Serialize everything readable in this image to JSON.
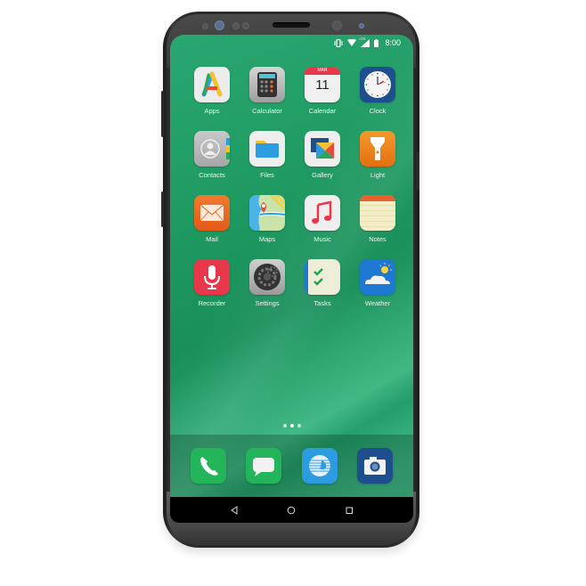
{
  "device": {
    "type": "smartphone",
    "wallpaper_colors": [
      "#2aa671",
      "#1a8f5a",
      "#39b884"
    ]
  },
  "status_bar": {
    "icons": [
      "vibrate-icon",
      "wifi-icon",
      "signal-icon",
      "battery-icon"
    ],
    "network_label": "LTE",
    "time": "8:00"
  },
  "home_screen": {
    "apps": [
      {
        "label": "Apps",
        "icon": "apps-icon"
      },
      {
        "label": "Calculator",
        "icon": "calculator-icon"
      },
      {
        "label": "Calendar",
        "icon": "calendar-icon",
        "month": "MAR",
        "day": "11"
      },
      {
        "label": "Clock",
        "icon": "clock-icon"
      },
      {
        "label": "Contacts",
        "icon": "contacts-icon"
      },
      {
        "label": "Files",
        "icon": "folder-icon"
      },
      {
        "label": "Gallery",
        "icon": "gallery-icon"
      },
      {
        "label": "Light",
        "icon": "flashlight-icon"
      },
      {
        "label": "Mail",
        "icon": "mail-icon"
      },
      {
        "label": "Maps",
        "icon": "map-icon"
      },
      {
        "label": "Music",
        "icon": "music-note-icon"
      },
      {
        "label": "Notes",
        "icon": "notes-icon"
      },
      {
        "label": "Recorder",
        "icon": "microphone-icon"
      },
      {
        "label": "Settings",
        "icon": "gear-icon"
      },
      {
        "label": "Tasks",
        "icon": "checklist-icon"
      },
      {
        "label": "Weather",
        "icon": "weather-icon"
      }
    ],
    "page_indicator": {
      "pages": 3,
      "current": 2
    }
  },
  "dock": {
    "apps": [
      {
        "name": "Phone",
        "icon": "phone-icon"
      },
      {
        "name": "Messages",
        "icon": "message-icon"
      },
      {
        "name": "Browser",
        "icon": "globe-icon"
      },
      {
        "name": "Camera",
        "icon": "camera-icon"
      }
    ]
  },
  "nav_bar": {
    "buttons": [
      {
        "name": "back",
        "icon": "back-triangle-icon"
      },
      {
        "name": "home",
        "icon": "home-circle-icon"
      },
      {
        "name": "recents",
        "icon": "recents-square-icon"
      }
    ]
  }
}
